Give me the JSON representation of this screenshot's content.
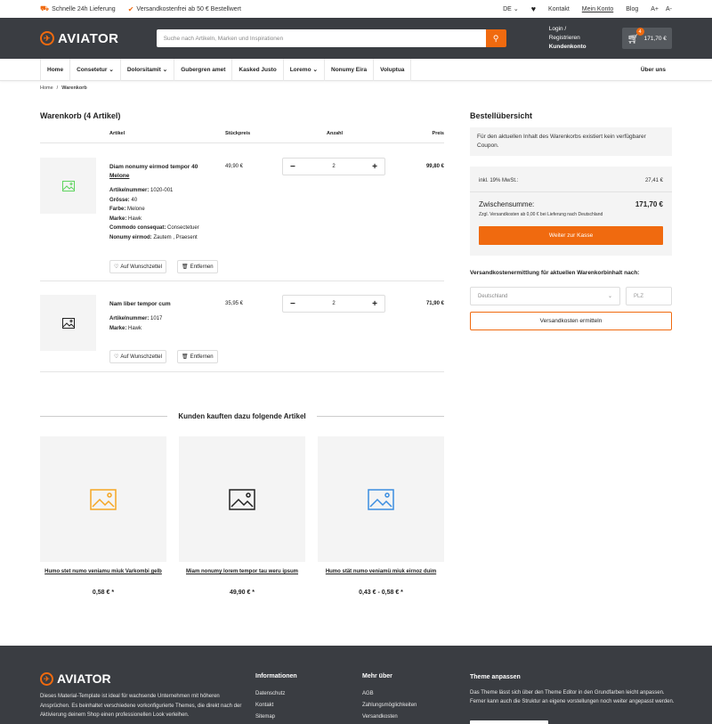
{
  "topbar": {
    "usp1": "Schnelle 24h Lieferung",
    "usp2": "Versandkostenfrei ab 50 € Bestellwert",
    "lang": "DE",
    "kontakt": "Kontakt",
    "mein_konto": "Mein Konto",
    "blog": "Blog",
    "font_up": "A+",
    "font_down": "A-"
  },
  "header": {
    "logo": "AVIATOR",
    "search_placeholder": "Suche nach Artikeln, Marken und Inspirationen",
    "login": "Login / Registrieren",
    "kundenkonto": "Kundenkonto",
    "cart_count": "4",
    "cart_total": "171,70 €"
  },
  "nav": {
    "items": [
      "Home",
      "Consetetur",
      "Dolorsitamit",
      "Gubergren amet",
      "Kasked Justo",
      "Loremo",
      "Nonumy Eira",
      "Voluptua"
    ],
    "ueber": "Über uns"
  },
  "breadcrumb": {
    "home": "Home",
    "sep": "/",
    "current": "Warenkorb"
  },
  "cart": {
    "title": "Warenkorb (4 Artikel)",
    "head": {
      "artikel": "Artikel",
      "stueckpreis": "Stückpreis",
      "anzahl": "Anzahl",
      "preis": "Preis"
    },
    "items": [
      {
        "name": "Diam nonumy eirmod tempor 40",
        "variant": "Melone",
        "attrs": [
          {
            "k": "Artikelnummer:",
            "v": "1020-001"
          },
          {
            "k": "Grösse:",
            "v": "40"
          },
          {
            "k": "Farbe:",
            "v": "Melone"
          },
          {
            "k": "Marke:",
            "v": "Hawk"
          },
          {
            "k": "Commodo consequat:",
            "v": "Consectetuer"
          },
          {
            "k": "Nonumy eirmod:",
            "v": "Zautem , Praesent"
          }
        ],
        "unit_price": "49,90 €",
        "qty": "2",
        "total": "99,80 €"
      },
      {
        "name": "Nam liber tempor cum",
        "variant": "",
        "attrs": [
          {
            "k": "Artikelnummer:",
            "v": "1017"
          },
          {
            "k": "Marke:",
            "v": "Hawk"
          }
        ],
        "unit_price": "35,95 €",
        "qty": "2",
        "total": "71,90 €"
      }
    ],
    "wishlist": "Auf Wunschzettel",
    "remove": "Entfernen",
    "minus": "−",
    "plus": "+"
  },
  "summary": {
    "title": "Bestellübersicht",
    "coupon": "Für den aktuellen Inhalt des Warenkorbs existiert kein verfügbarer Coupon.",
    "mwst_label": "inkl. 19% MwSt.:",
    "mwst_value": "27,41 €",
    "zwischensumme_label": "Zwischensumme:",
    "zwischensumme_value": "171,70 €",
    "shipping_note": "Zzgl. Versandkosten ab 0,00 € bei Lieferung nach Deutschland",
    "checkout": "Weiter zur Kasse",
    "ship_title": "Versandkostenermittlung für aktuellen Warenkorbinhalt nach:",
    "country": "Deutschland",
    "plz_placeholder": "PLZ",
    "calc": "Versandkosten ermitteln"
  },
  "reco": {
    "title": "Kunden kauften dazu folgende Artikel",
    "items": [
      {
        "name": "Humo stet numo veniamu miuk Varkombi gelb",
        "price": "0,58 € *",
        "color": "#f5a623"
      },
      {
        "name": "Miam nonumy lorem tempor tau weru ipsum",
        "price": "49,90 € *",
        "color": "#222222"
      },
      {
        "name": "Humo stät numo veniamü miuk eirnoz duim",
        "price": "0,43 € - 0,58 € *",
        "color": "#3b8de0"
      }
    ]
  },
  "footer": {
    "logo": "AVIATOR",
    "desc": "Dieses Material-Template ist ideal für wachsende Unternehmen mit höheren Ansprüchen. Es beinhaltet verschiedene vorkonfigurierte Themes, die direkt nach der Aktivierung deinem Shop einen professionellen Look verleihen.",
    "col1": {
      "title": "Informationen",
      "links": [
        "Datenschutz",
        "Kontakt",
        "Sitemap"
      ]
    },
    "col2": {
      "title": "Mehr über",
      "links": [
        "AGB",
        "Zahlungsmöglichkeiten",
        "Versandkosten"
      ]
    },
    "theme_title": "Theme anpassen",
    "theme_text": "Das Theme lässt sich über den Theme Editor in den Grundfarben leicht anpassen. Ferner kann auch die Struktur an eigene vorstellungen noch weiter angepasst werden."
  },
  "colors": {
    "accent": "#f06a0f",
    "header_bg": "#3a3d42",
    "panel_bg": "#f4f4f4"
  }
}
